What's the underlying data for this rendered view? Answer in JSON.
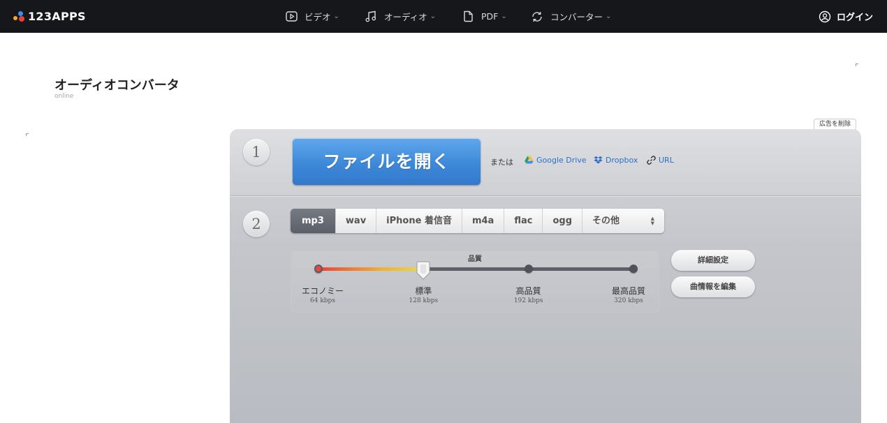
{
  "brand": {
    "name": "123APPS"
  },
  "nav": {
    "video": "ビデオ",
    "audio": "オーディオ",
    "pdf": "PDF",
    "converter": "コンバーター",
    "login": "ログイン"
  },
  "page": {
    "title": "オーディオコンバータ",
    "subtitle": "online",
    "remove_ads": "広告を削除"
  },
  "step1": {
    "number": "1",
    "open_button": "ファイルを開く",
    "or_text": "または",
    "sources": {
      "google_drive": "Google Drive",
      "dropbox": "Dropbox",
      "url": "URL"
    }
  },
  "step2": {
    "number": "2",
    "formats": [
      {
        "label": "mp3",
        "active": true
      },
      {
        "label": "wav",
        "active": false
      },
      {
        "label": "iPhone 着信音",
        "active": false
      },
      {
        "label": "m4a",
        "active": false
      },
      {
        "label": "flac",
        "active": false
      },
      {
        "label": "ogg",
        "active": false
      },
      {
        "label": "その他",
        "active": false
      }
    ],
    "quality": {
      "title": "品質",
      "selected_index": 1,
      "stops": [
        {
          "label": "エコノミー",
          "rate": "64 kbps"
        },
        {
          "label": "標準",
          "rate": "128 kbps"
        },
        {
          "label": "高品質",
          "rate": "192 kbps"
        },
        {
          "label": "最高品質",
          "rate": "320 kbps"
        }
      ]
    },
    "advanced_button": "詳細設定",
    "edit_info_button": "曲情報を編集"
  },
  "colors": {
    "topbar": "#16171b",
    "open_button": "#3d88d9",
    "link": "#2a6fc9",
    "active_tab": "#5a5f68"
  }
}
